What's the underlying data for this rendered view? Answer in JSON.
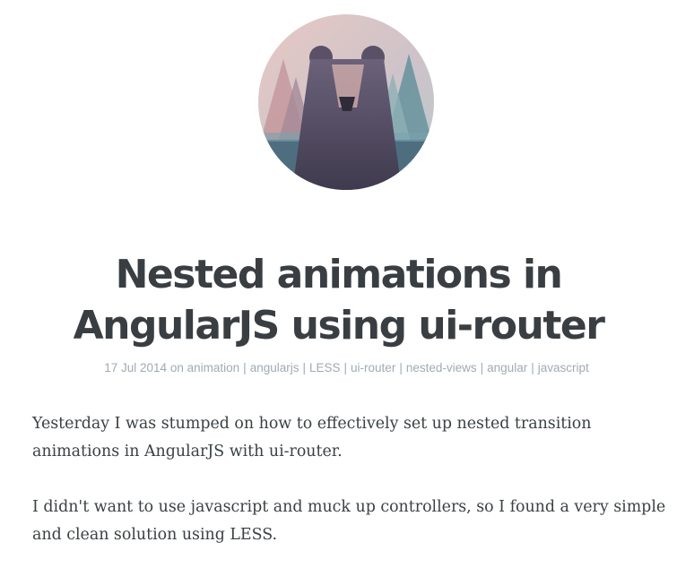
{
  "post": {
    "title_line_1": "Nested animations in",
    "title_line_2": "AngularJS using ui-router",
    "date": "17 Jul 2014",
    "on_word": "on",
    "tags": [
      "animation",
      "angularjs",
      "LESS",
      "ui-router",
      "nested-views",
      "angular",
      "javascript"
    ],
    "tag_separator": "|",
    "paragraphs": [
      "Yesterday I was stumped on how to effectively set up nested transition animations in AngularJS with ui-router.",
      "I didn't want to use javascript and muck up controllers, so I found a very simple and clean solution using LESS."
    ]
  },
  "colors": {
    "title": "#393e42",
    "meta": "#9eabb3",
    "body_text": "#3a4145"
  }
}
